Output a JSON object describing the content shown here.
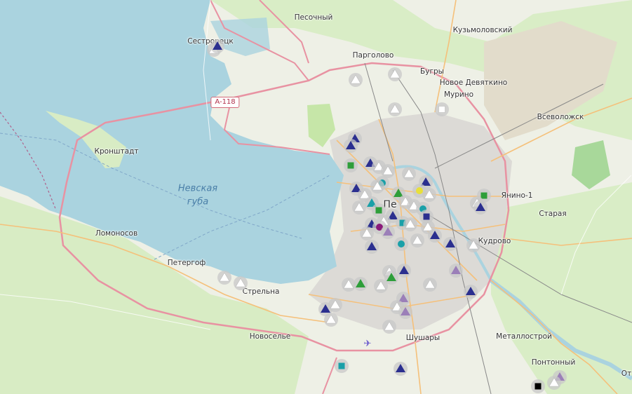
{
  "map": {
    "road_shield": "A-118",
    "water_label_line1": "Невская",
    "water_label_line2": "губа",
    "places": [
      {
        "name": "Песочный"
      },
      {
        "name": "Кузьмоловский"
      },
      {
        "name": "Сестрорецк"
      },
      {
        "name": "Парголово"
      },
      {
        "name": "Бугры"
      },
      {
        "name": "Новое Девяткино"
      },
      {
        "name": "Мурино"
      },
      {
        "name": "Всеволожск"
      },
      {
        "name": "Кронштадт"
      },
      {
        "name": "Янино-1"
      },
      {
        "name": "Старая"
      },
      {
        "name": "Кудрово"
      },
      {
        "name": "Ломоносов"
      },
      {
        "name": "Петергоф"
      },
      {
        "name": "Стрельна"
      },
      {
        "name": "Новоселье"
      },
      {
        "name": "Шушары"
      },
      {
        "name": "Металлострой"
      },
      {
        "name": "Понтонный"
      },
      {
        "name": "Пе"
      },
      {
        "name": "От"
      }
    ],
    "colors": {
      "water": "#aad3df",
      "land": "#f2efe9",
      "green": "#cdebb0",
      "trunk_road": "#e892a2",
      "primary_road": "#fcd6a4",
      "marker_navy": "#2b2f8f",
      "marker_green": "#2e9e3a",
      "marker_teal": "#1aa0a8",
      "marker_purple": "#9b7fb8",
      "marker_yellow": "#e8e03a",
      "marker_white": "#ffffff",
      "marker_magenta": "#8a1a7a",
      "marker_black": "#000000"
    }
  }
}
